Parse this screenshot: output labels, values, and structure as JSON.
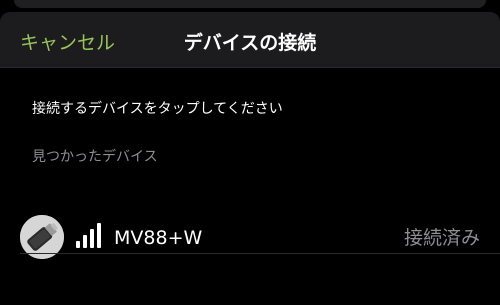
{
  "navbar": {
    "cancel_label": "キャンセル",
    "title": "デバイスの接続"
  },
  "instruction": "接続するデバイスをタップしてください",
  "section_header": "見つかったデバイス",
  "devices": [
    {
      "name": "MV88+W",
      "status": "接続済み",
      "signal_bars": 4,
      "signal_icon": "signal-bars-icon",
      "thumbnail_icon": "microphone-icon"
    }
  ],
  "colors": {
    "accent": "#97c459",
    "background": "#000000",
    "navbar": "#1c1c1e",
    "secondary_text": "#8e8e93"
  }
}
